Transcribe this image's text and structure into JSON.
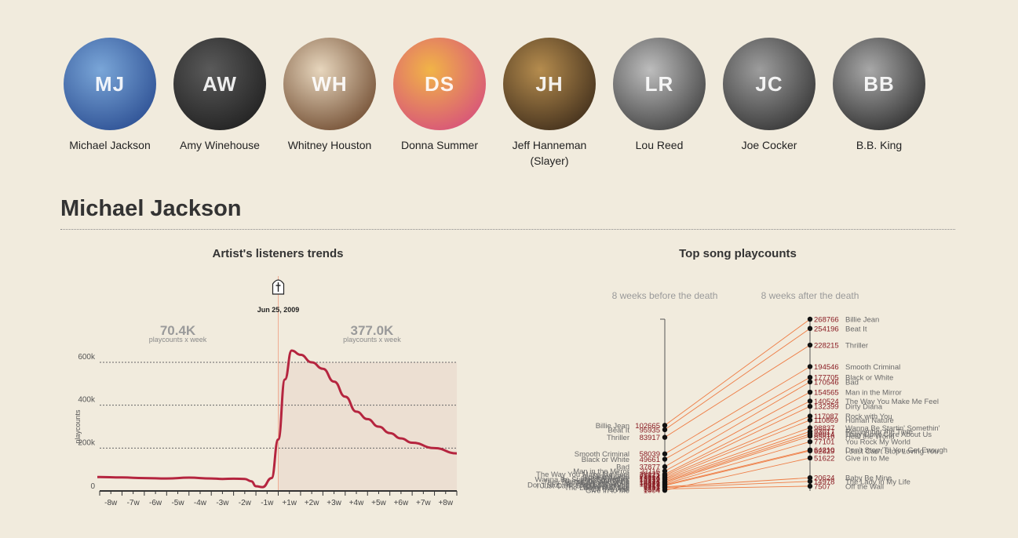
{
  "artists": [
    {
      "name": "Michael Jackson",
      "initials": "MJ",
      "color_from": "#1e3f86",
      "color_to": "#7aa6d8"
    },
    {
      "name": "Amy Winehouse",
      "initials": "AW",
      "color_from": "#161616",
      "color_to": "#5a5a5a"
    },
    {
      "name": "Whitney Houston",
      "initials": "WH",
      "color_from": "#5c3418",
      "color_to": "#e7d6bd"
    },
    {
      "name": "Donna Summer",
      "initials": "DS",
      "color_from": "#d23e86",
      "color_to": "#f1b447"
    },
    {
      "name": "Jeff Hanneman (Slayer)",
      "initials": "JH",
      "color_from": "#2b1d12",
      "color_to": "#b58c4e"
    },
    {
      "name": "Lou Reed",
      "initials": "LR",
      "color_from": "#2c2c2c",
      "color_to": "#bdbdbd"
    },
    {
      "name": "Joe Cocker",
      "initials": "JC",
      "color_from": "#222222",
      "color_to": "#9d9d9d"
    },
    {
      "name": "B.B. King",
      "initials": "BB",
      "color_from": "#1a1a1a",
      "color_to": "#a8a8a8"
    }
  ],
  "selected_artist": {
    "name": "Michael Jackson"
  },
  "colors": {
    "line": "#b5253f",
    "death_line": "#efac93",
    "after_fill": "#ecdfd2",
    "slope": "#ee7c44",
    "value_text": "#8a1d24"
  },
  "chart_data": [
    {
      "type": "line",
      "title": "Artist's listeners trends",
      "ylabel": "playcounts",
      "yticks": [
        0,
        200000,
        400000,
        600000
      ],
      "ytick_labels": [
        "0",
        "200k",
        "400k",
        "600k"
      ],
      "ylim": [
        0,
        600000
      ],
      "xlim": [
        -8,
        8
      ],
      "xtick_labels": [
        "-8w",
        "-7w",
        "-6w",
        "-5w",
        "-4w",
        "-3w",
        "-2w",
        "-1w",
        "+1w",
        "+2w",
        "+3w",
        "+4w",
        "+5w",
        "+6w",
        "+7w",
        "+8w"
      ],
      "marker": {
        "label": "Jun 25, 2009",
        "icon": "tombstone-icon",
        "x": 0
      },
      "before": {
        "value": "70.4K",
        "label": "playcounts x week"
      },
      "after": {
        "value": "377.0K",
        "label": "playcounts x week"
      },
      "series": [
        {
          "x": [
            -8.5,
            -7,
            -6,
            -5,
            -4,
            -3,
            -2.5,
            -2,
            -1.5,
            -1.2,
            -1,
            -0.7,
            -0.3,
            0,
            0.3,
            0.6,
            1,
            1.5,
            2,
            2.5,
            3,
            3.5,
            4,
            4.5,
            5,
            5.5,
            6,
            7,
            8
          ],
          "y": [
            65000,
            63000,
            60000,
            58000,
            62000,
            58000,
            56000,
            57000,
            56000,
            45000,
            22000,
            18000,
            60000,
            240000,
            520000,
            655000,
            635000,
            600000,
            570000,
            510000,
            440000,
            370000,
            335000,
            300000,
            270000,
            245000,
            225000,
            200000,
            175000
          ]
        }
      ]
    },
    {
      "type": "slope",
      "title": "Top song playcounts",
      "left_label": "8 weeks before the death",
      "right_label": "8 weeks after the death",
      "songs": [
        {
          "name": "Billie Jean",
          "before": 102665,
          "after": 268766
        },
        {
          "name": "Beat It",
          "before": 95935,
          "after": 254196
        },
        {
          "name": "Thriller",
          "before": 83917,
          "after": 228215
        },
        {
          "name": "Smooth Criminal",
          "before": 58039,
          "after": 194546
        },
        {
          "name": "Black or White",
          "before": 49661,
          "after": 177705
        },
        {
          "name": "Bad",
          "before": 37877,
          "after": 170546
        },
        {
          "name": "Man in the Mirror",
          "before": 31116,
          "after": 154565
        },
        {
          "name": "The Way You Make Me Feel",
          "before": 26175,
          "after": 140524
        },
        {
          "name": "Dirty Diana",
          "before": 23871,
          "after": 132399
        },
        {
          "name": "Rock with You",
          "before": 21964,
          "after": 117087
        },
        {
          "name": "Human Nature",
          "before": 19676,
          "after": 110869
        },
        {
          "name": "Wanna Be Startin' Somethin'",
          "before": 18219,
          "after": 98837
        },
        {
          "name": "Remember the Time",
          "before": 16124,
          "after": 93017
        },
        {
          "name": "They Don't Care About Us",
          "before": 14376,
          "after": 89014
        },
        {
          "name": "Heal the World",
          "before": 12881,
          "after": 85816
        },
        {
          "name": "You Rock My World",
          "before": 10975,
          "after": 77101
        },
        {
          "name": "Don't Stop 'Til You Get Enough",
          "before": 9624,
          "after": 64210
        },
        {
          "name": "I Just Can't Stop Loving You",
          "before": 8312,
          "after": 62829
        },
        {
          "name": "Give in to Me",
          "before": 1004,
          "after": 51622
        },
        {
          "name": "Baby Be Mine",
          "before": 6451,
          "after": 20624
        },
        {
          "name": "The Lady in My Life",
          "before": 5293,
          "after": 14978
        },
        {
          "name": "Off the Wall",
          "before": 3174,
          "after": 7507
        }
      ]
    }
  ]
}
